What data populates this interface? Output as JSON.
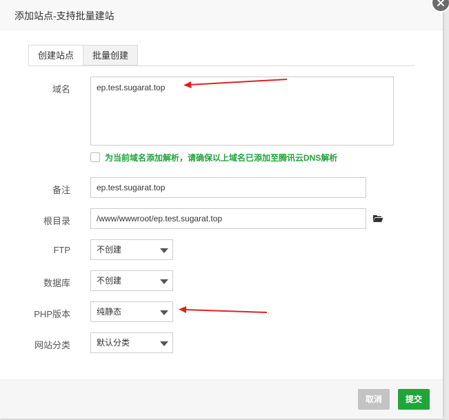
{
  "dialog": {
    "title": "添加站点-支持批量建站"
  },
  "tabs": [
    {
      "label": "创建站点",
      "active": true
    },
    {
      "label": "批量创建",
      "active": false
    }
  ],
  "form": {
    "domain_label": "域名",
    "domain_value": "ep.test.sugarat.top",
    "dns_checkbox_label": "为当前域名添加解析，请确保以上域名已添加至腾讯云DNS解析",
    "remark_label": "备注",
    "remark_value": "ep.test.sugarat.top",
    "root_label": "根目录",
    "root_value": "/www/wwwroot/ep.test.sugarat.top",
    "ftp_label": "FTP",
    "ftp_value": "不创建",
    "db_label": "数据库",
    "db_value": "不创建",
    "php_label": "PHP版本",
    "php_value": "纯静态",
    "category_label": "网站分类",
    "category_value": "默认分类"
  },
  "footer": {
    "cancel_label": "取消",
    "submit_label": "提交"
  },
  "colors": {
    "accent_green": "#20a53a",
    "annotation_red": "#e02020"
  },
  "icons": [
    "close-icon",
    "folder-open-icon",
    "chevron-down-icon"
  ]
}
